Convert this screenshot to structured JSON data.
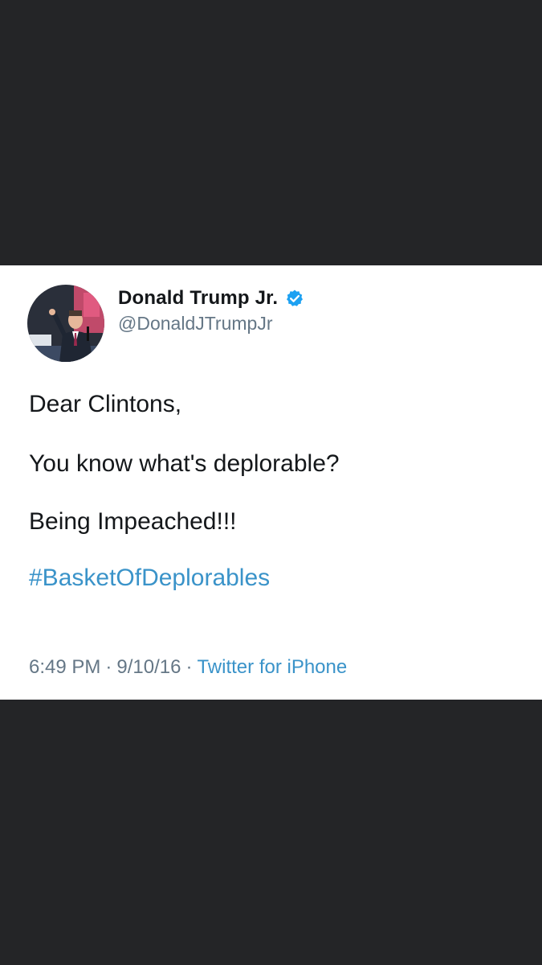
{
  "tweet": {
    "author": {
      "name": "Donald Trump Jr.",
      "handle": "@DonaldJTrumpJr",
      "verified": true,
      "avatar_icon": "profile-photo"
    },
    "text_lines": [
      "Dear Clintons,",
      "You know what's deplorable?",
      "Being Impeached!!!",
      "#BasketOfDeplorables"
    ],
    "meta": {
      "time": "6:49 PM",
      "date": "9/10/16",
      "separator": "·",
      "source": "Twitter for iPhone"
    }
  },
  "colors": {
    "background": "#242527",
    "card": "#ffffff",
    "text": "#14171a",
    "secondary": "#657786",
    "link": "#3a93c9",
    "verified": "#1da1f2"
  }
}
